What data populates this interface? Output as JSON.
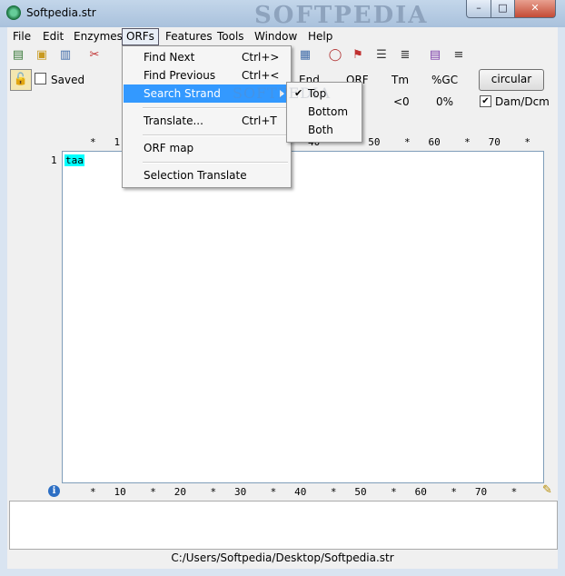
{
  "window": {
    "title": "Softpedia.str",
    "watermark": "SOFTPEDIA",
    "controls": {
      "minimize": "–",
      "maximize": "□",
      "close": "✕"
    }
  },
  "menubar": [
    "File",
    "Edit",
    "Enzymes",
    "ORFs",
    "Features",
    "Tools",
    "Window",
    "Help"
  ],
  "info": {
    "saved_label": "Saved",
    "headers": {
      "end": "End",
      "orf": "ORF",
      "tm": "Tm",
      "gc": "%GC"
    },
    "values": {
      "tm": "<0",
      "gc": "0%"
    },
    "circular_label": "circular",
    "damdcm_label": "Dam/Dcm",
    "damdcm_checked": true,
    "saved_checked": false
  },
  "ruler": {
    "top": "*   1",
    "top_right": "40    *   50    *   60    *   70    *",
    "bottom": "*   10    *   20    *   30    *   40    *   50    *   60    *   70    *"
  },
  "sequence": {
    "line_number": "1",
    "text": "taa"
  },
  "status": {
    "path": "C:/Users/Softpedia/Desktop/Softpedia.str"
  },
  "orfs_menu": {
    "items": [
      {
        "label": "Find Next",
        "shortcut": "Ctrl+>"
      },
      {
        "label": "Find Previous",
        "shortcut": "Ctrl+<"
      },
      {
        "label": "Search Strand",
        "shortcut": ""
      },
      {
        "label": "Translate...",
        "shortcut": "Ctrl+T"
      },
      {
        "label": "ORF map",
        "shortcut": ""
      },
      {
        "label": "Selection Translate",
        "shortcut": ""
      }
    ]
  },
  "strand_menu": {
    "items": [
      {
        "label": "Top",
        "checked": true
      },
      {
        "label": "Bottom",
        "checked": false
      },
      {
        "label": "Both",
        "checked": false
      }
    ],
    "check_glyph": "✔"
  },
  "icons": [
    "new-icon",
    "open-icon",
    "save-icon",
    "cut-icon",
    "grid-icon",
    "circle-map-icon",
    "flag-icon",
    "list-icon",
    "text-icon",
    "bars-icon",
    "lines-icon",
    "lock-icon",
    "info-icon",
    "pencil-icon"
  ]
}
